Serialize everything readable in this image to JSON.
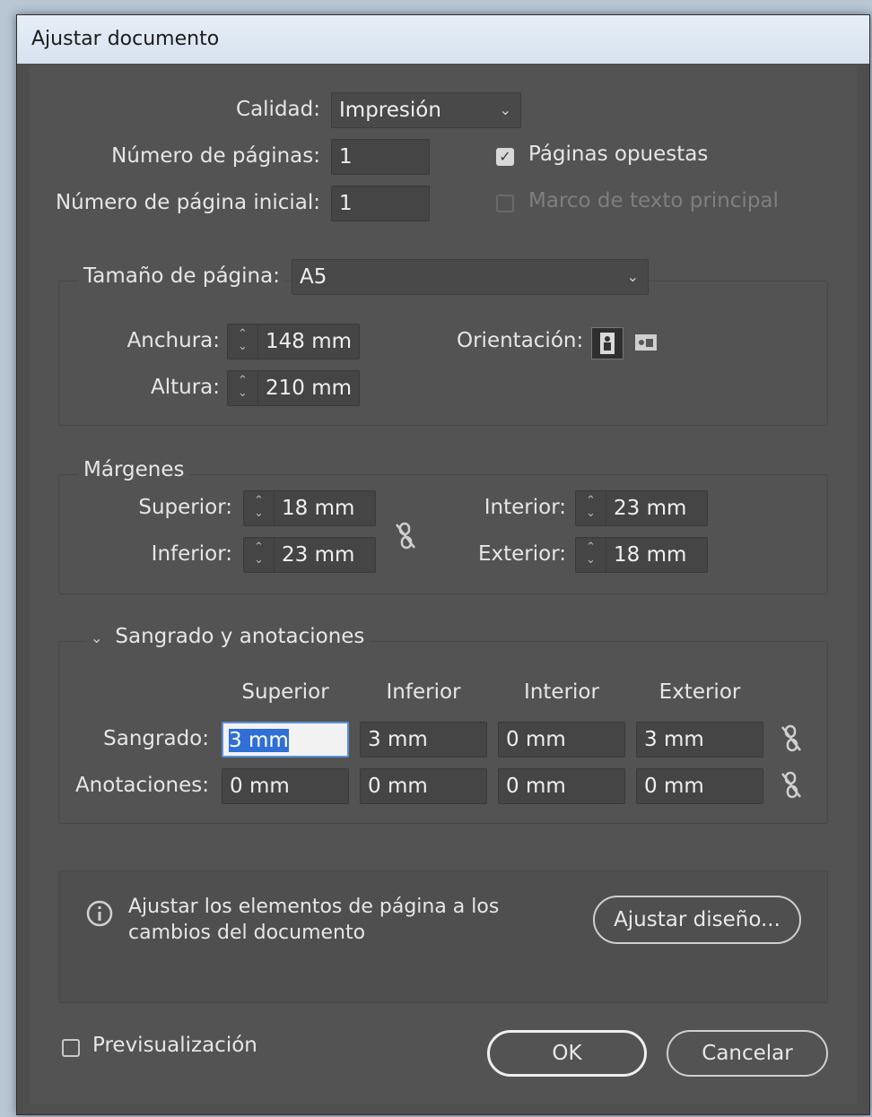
{
  "window": {
    "title": "Ajustar documento"
  },
  "top": {
    "quality_label": "Calidad:",
    "quality_value": "Impresión",
    "pages_label": "Número de páginas:",
    "pages_value": "1",
    "start_page_label": "Número de página inicial:",
    "start_page_value": "1",
    "facing_pages_label": "Páginas opuestas",
    "facing_pages_checked": true,
    "primary_text_frame_label": "Marco de texto principal",
    "primary_text_frame_checked": false
  },
  "page_size": {
    "label": "Tamaño de página:",
    "value": "A5",
    "width_label": "Anchura:",
    "width_value": "148 mm",
    "height_label": "Altura:",
    "height_value": "210 mm",
    "orientation_label": "Orientación:",
    "orientation_selected": "portrait"
  },
  "margins": {
    "title": "Márgenes",
    "top_label": "Superior:",
    "top_value": "18 mm",
    "bottom_label": "Inferior:",
    "bottom_value": "23 mm",
    "inside_label": "Interior:",
    "inside_value": "23 mm",
    "outside_label": "Exterior:",
    "outside_value": "18 mm"
  },
  "bleed": {
    "title": "Sangrado y anotaciones",
    "columns": [
      "Superior",
      "Inferior",
      "Interior",
      "Exterior"
    ],
    "bleed_label": "Sangrado:",
    "bleed_values": [
      "3 mm",
      "3 mm",
      "0 mm",
      "3 mm"
    ],
    "slug_label": "Anotaciones:",
    "slug_values": [
      "0 mm",
      "0 mm",
      "0 mm",
      "0 mm"
    ]
  },
  "adjust": {
    "info_line1": "Ajustar los elementos de página a los",
    "info_line2": "cambios del documento",
    "button_label": "Ajustar diseño..."
  },
  "footer": {
    "preview_label": "Previsualización",
    "preview_checked": false,
    "ok_label": "OK",
    "cancel_label": "Cancelar"
  },
  "colors": {
    "dialog_bg": "#535353",
    "field_bg": "#454545",
    "highlight": "#2f6fd6"
  }
}
